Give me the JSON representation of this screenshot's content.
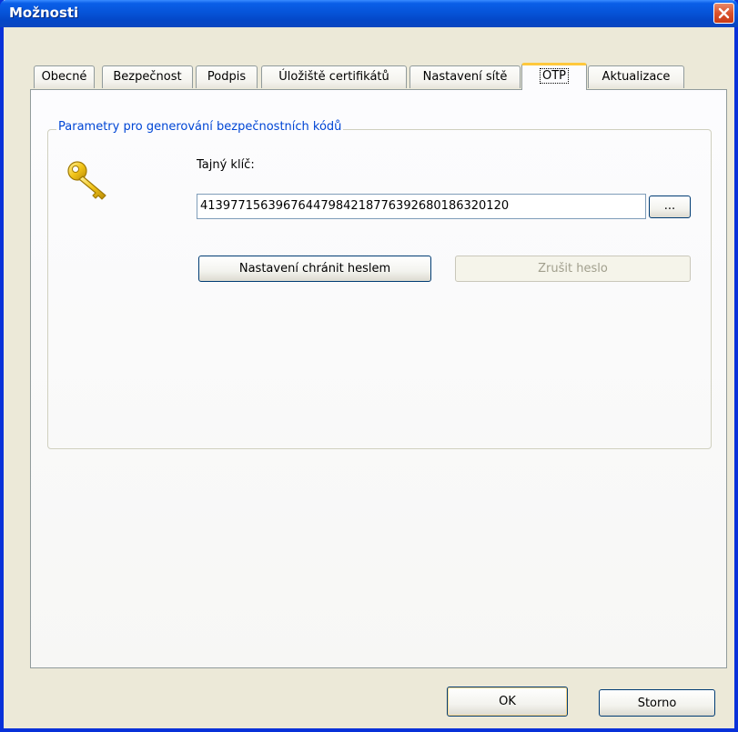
{
  "window": {
    "title": "Možnosti"
  },
  "tabs": [
    {
      "label": "Obecné"
    },
    {
      "label": "Bezpečnost"
    },
    {
      "label": "Podpis"
    },
    {
      "label": "Úložiště certifikátů"
    },
    {
      "label": "Nastavení sítě"
    },
    {
      "label": "OTP",
      "active": true
    },
    {
      "label": "Aktualizace"
    }
  ],
  "group": {
    "legend": "Parametry pro generování bezpečnostních kódů",
    "icon": "key-icon",
    "secret_label": "Tajný klíč:",
    "secret_value": "41397715639676447984218776392680186320120",
    "browse_label": "...",
    "protect_button": "Nastavení chránit heslem",
    "cancel_password_button": "Zrušit heslo"
  },
  "footer": {
    "ok_label": "OK",
    "cancel_label": "Storno"
  },
  "colors": {
    "titlebar": "#0654d9",
    "legend": "#0046d5",
    "close": "#d9522c",
    "active_tab": "#ffc83c"
  }
}
